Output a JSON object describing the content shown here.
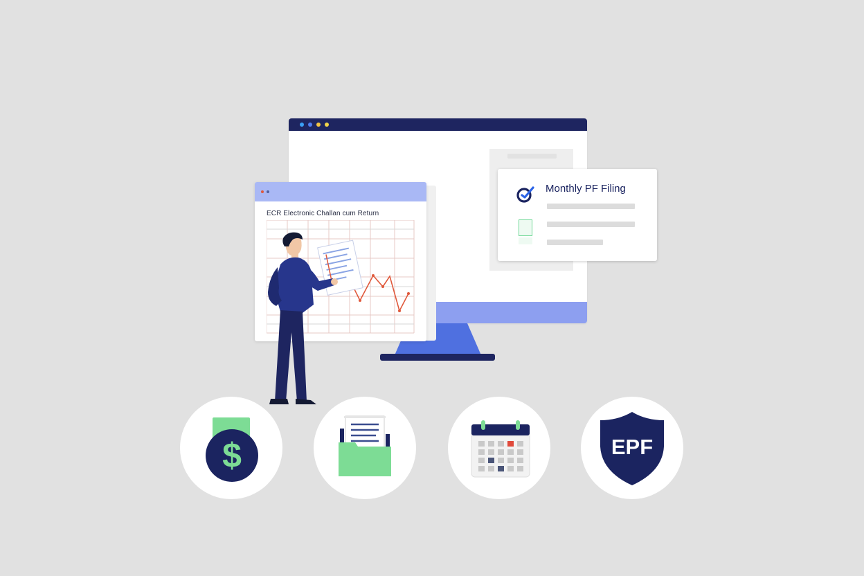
{
  "ecr_window": {
    "title": "ECR Electronic Challan cum Return"
  },
  "filing_card": {
    "title": "Monthly PF Filing",
    "check_icon": "check-target-icon",
    "colors": {
      "accent": "#2b63e6",
      "navy": "#1b2460",
      "green": "#6fd896"
    }
  },
  "icons": [
    {
      "name": "dollar-coin-icon"
    },
    {
      "name": "folder-document-icon"
    },
    {
      "name": "calendar-icon"
    },
    {
      "name": "shield-icon",
      "label": "EPF"
    }
  ],
  "colors": {
    "background": "#e1e1e1",
    "navy": "#1e2560",
    "blue": "#4f70e0",
    "light_blue": "#8d9ff0",
    "green": "#7ddc95",
    "red_line": "#e0593c"
  }
}
